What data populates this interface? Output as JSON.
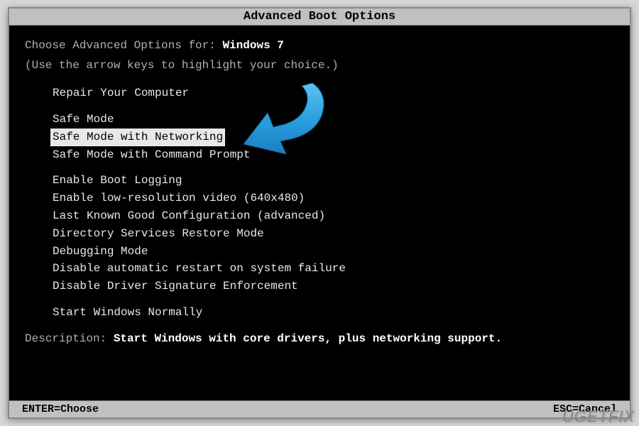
{
  "title": "Advanced Boot Options",
  "header": {
    "prompt": "Choose Advanced Options for:",
    "os": "Windows 7",
    "instruction": "(Use the arrow keys to highlight your choice.)"
  },
  "menu": {
    "group1": [
      "Repair Your Computer"
    ],
    "group2": [
      "Safe Mode",
      "Safe Mode with Networking",
      "Safe Mode with Command Prompt"
    ],
    "group3": [
      "Enable Boot Logging",
      "Enable low-resolution video (640x480)",
      "Last Known Good Configuration (advanced)",
      "Directory Services Restore Mode",
      "Debugging Mode",
      "Disable automatic restart on system failure",
      "Disable Driver Signature Enforcement"
    ],
    "group4": [
      "Start Windows Normally"
    ],
    "selected": "Safe Mode with Networking"
  },
  "description": {
    "label": "Description:",
    "text": "Start Windows with core drivers, plus networking support."
  },
  "footer": {
    "left": "ENTER=Choose",
    "right": "ESC=Cancel"
  },
  "watermark": "UGETFIX",
  "arrow_color": "#2b9fe0"
}
